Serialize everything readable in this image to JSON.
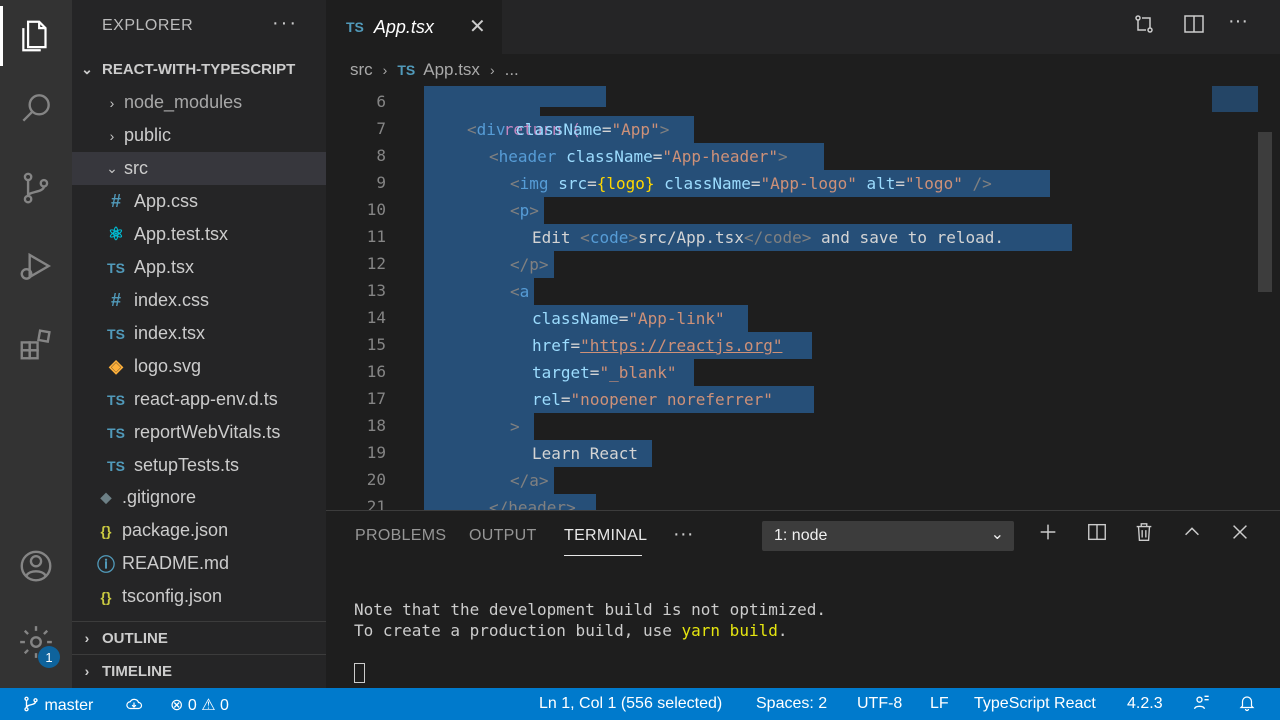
{
  "explorer": {
    "title": "EXPLORER",
    "more": "···",
    "project": "REACT-WITH-TYPESCRIPT",
    "items": [
      {
        "label": "node_modules",
        "icon": "›",
        "kind": "folder",
        "dim": true
      },
      {
        "label": "public",
        "icon": "›",
        "kind": "folder"
      },
      {
        "label": "src",
        "icon": "⌄",
        "kind": "folder-open"
      },
      {
        "label": "App.css",
        "icon": "#"
      },
      {
        "label": "App.test.tsx",
        "icon": "⚛"
      },
      {
        "label": "App.tsx",
        "icon": "TS"
      },
      {
        "label": "index.css",
        "icon": "#"
      },
      {
        "label": "index.tsx",
        "icon": "TS"
      },
      {
        "label": "logo.svg",
        "icon": "◈"
      },
      {
        "label": "react-app-env.d.ts",
        "icon": "TS"
      },
      {
        "label": "reportWebVitals.ts",
        "icon": "TS"
      },
      {
        "label": "setupTests.ts",
        "icon": "TS"
      },
      {
        "label": ".gitignore",
        "icon": "◆"
      },
      {
        "label": "package.json",
        "icon": "{}"
      },
      {
        "label": "README.md",
        "icon": "ⓘ"
      },
      {
        "label": "tsconfig.json",
        "icon": "{}"
      }
    ],
    "outline": "OUTLINE",
    "timeline": "TIMELINE"
  },
  "tab": {
    "badge": "TS",
    "name": "App.tsx",
    "close": "✕"
  },
  "breadcrumb": {
    "folder": "src",
    "sep": "›",
    "badge": "TS",
    "file": "App.tsx",
    "sep2": "›",
    "more": "..."
  },
  "editor": {
    "lines": [
      {
        "n": "6"
      },
      {
        "n": "7"
      },
      {
        "n": "8"
      },
      {
        "n": "9"
      },
      {
        "n": "10"
      },
      {
        "n": "11"
      },
      {
        "n": "12"
      },
      {
        "n": "13"
      },
      {
        "n": "14"
      },
      {
        "n": "15"
      },
      {
        "n": "16"
      },
      {
        "n": "17"
      },
      {
        "n": "18"
      },
      {
        "n": "19"
      },
      {
        "n": "20"
      },
      {
        "n": "21"
      }
    ],
    "code": {
      "l6": "return (",
      "l7_open": "<",
      "l7_el": "div",
      "l7_attr": "className",
      "l7_eq": "=",
      "l7_val": "\"App\"",
      "l7_close": ">",
      "l8_el": "header",
      "l8_attr": "className",
      "l8_val": "\"App-header\"",
      "l9_el": "img",
      "l9_attr1": "src",
      "l9_expr": "{logo}",
      "l9_attr2": "className",
      "l9_val2": "\"App-logo\"",
      "l9_attr3": "alt",
      "l9_val3": "\"logo\"",
      "l9_end": "/>",
      "l10_el": "p",
      "l11_text1": "Edit ",
      "l11_el": "code",
      "l11_text2": "src/App.tsx",
      "l11_close": "</code>",
      "l11_text3": " and save to reload.",
      "l12_close": "</p>",
      "l13_el": "a",
      "l14_attr": "className",
      "l14_val": "\"App-link\"",
      "l15_attr": "href",
      "l15_val": "\"https://reactjs.org\"",
      "l16_attr": "target",
      "l16_val": "\"_blank\"",
      "l17_attr": "rel",
      "l17_val": "\"noopener noreferrer\"",
      "l18": ">",
      "l19": "Learn React",
      "l20": "</a>",
      "l21": "</header>"
    }
  },
  "panel": {
    "tabs": [
      "PROBLEMS",
      "OUTPUT",
      "TERMINAL"
    ],
    "more": "···",
    "terminal_select": "1: node",
    "terminal_lines": {
      "line1": "Note that the development build is not optimized.",
      "line2_pre": "To create a production build, use ",
      "line2_cmd": "yarn build",
      "line2_post": "."
    }
  },
  "status": {
    "branch": "master",
    "errors": "0",
    "warnings": "0",
    "position": "Ln 1, Col 1 (556 selected)",
    "spaces": "Spaces: 2",
    "encoding": "UTF-8",
    "eol": "LF",
    "language": "TypeScript React",
    "version": "4.2.3"
  },
  "badges": {
    "settings": "1"
  },
  "colors": {
    "statusbar": "#007acc",
    "selection": "#264f78",
    "accent": "#0e639c"
  }
}
